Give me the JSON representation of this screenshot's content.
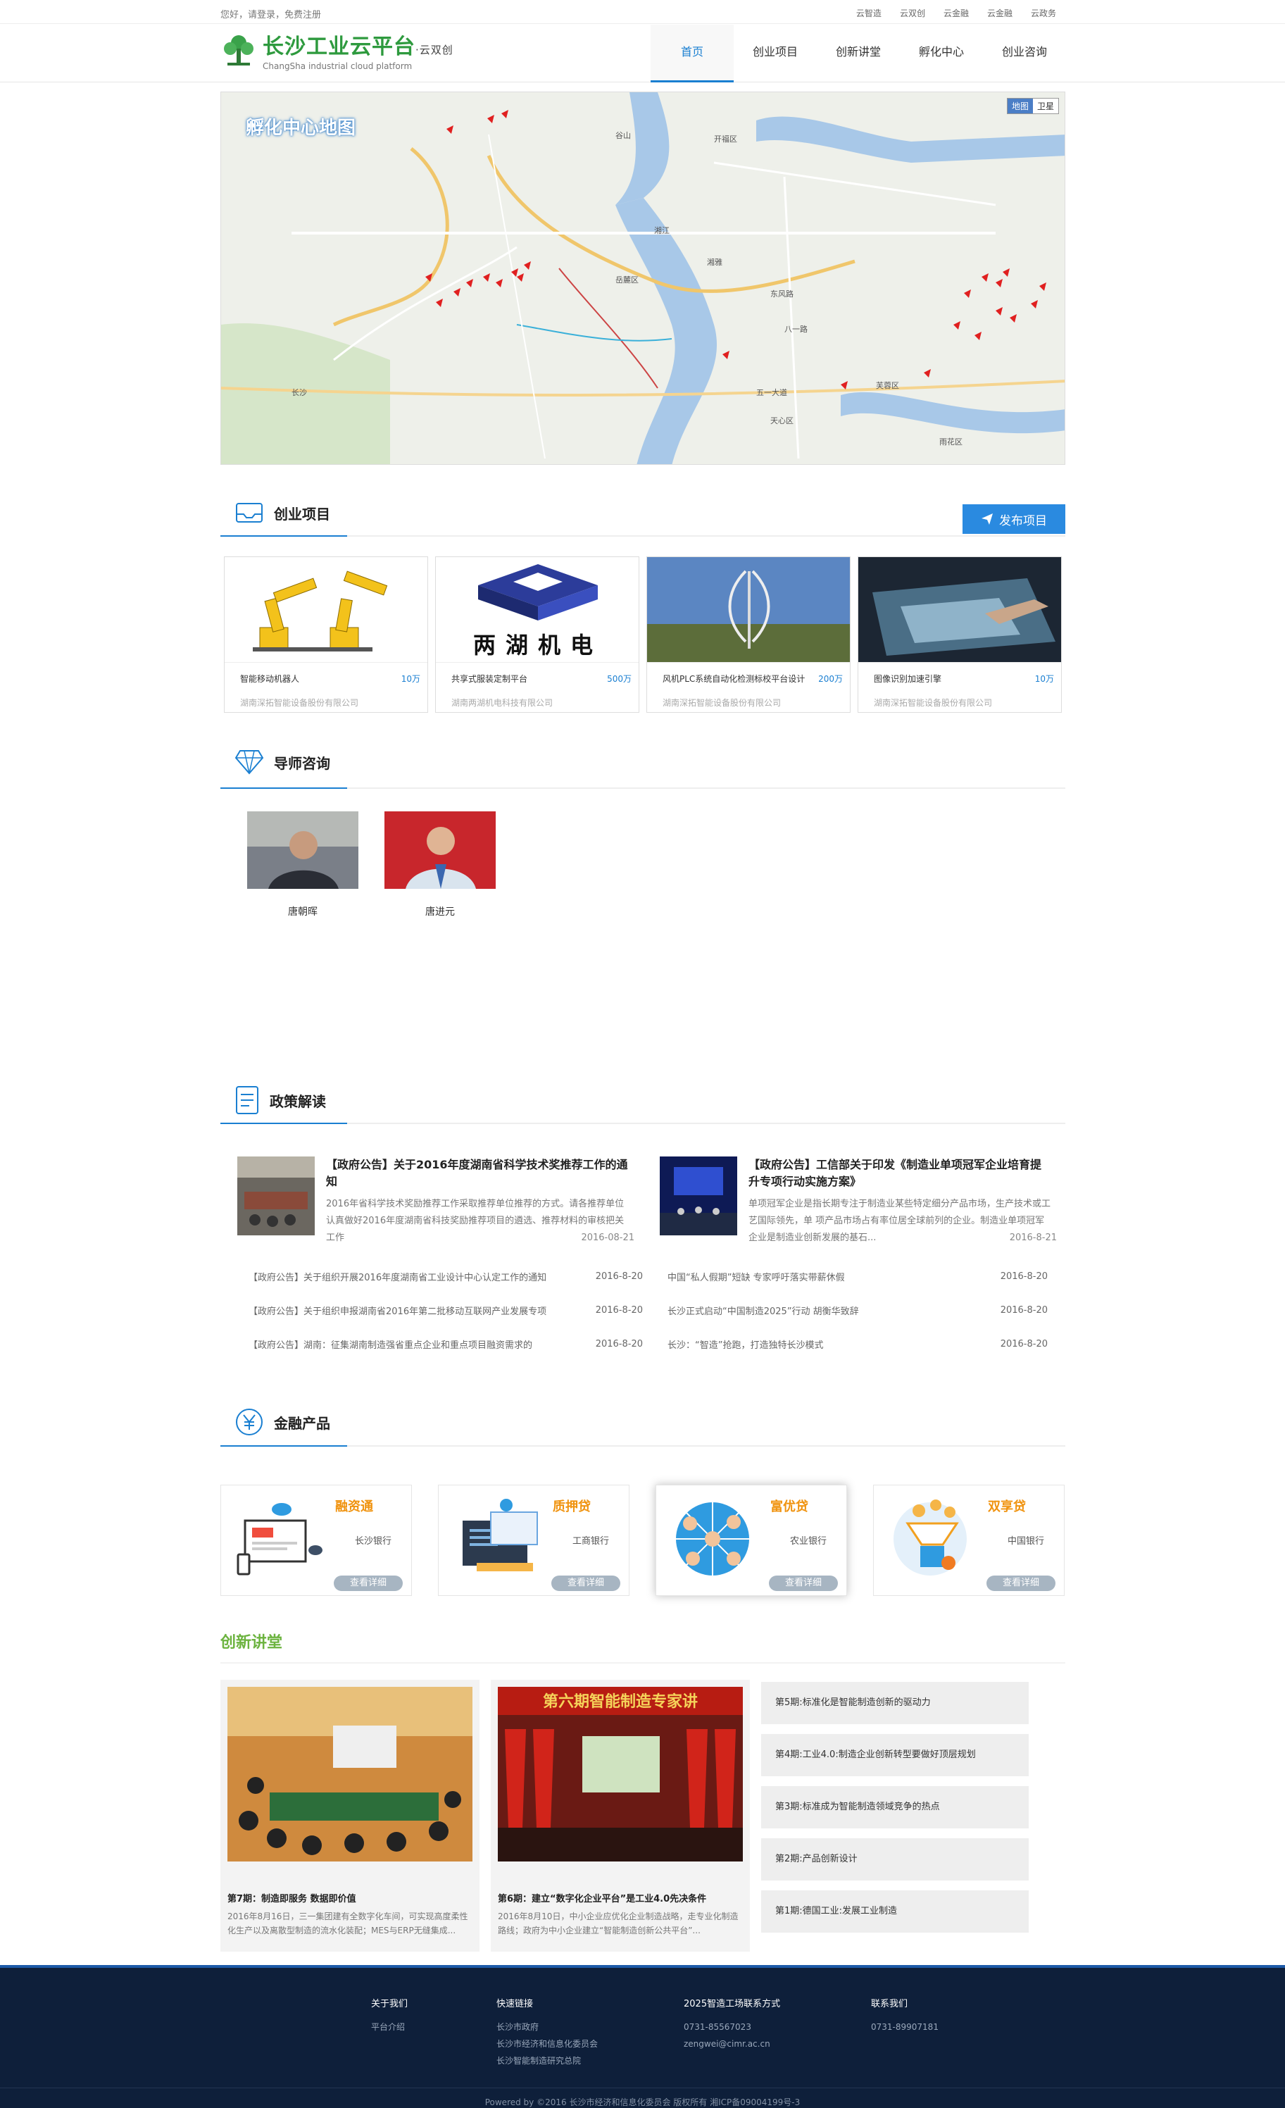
{
  "topbar": {
    "greeting": "您好，请登录，免费注册",
    "links": [
      "云智造",
      "云双创",
      "云金融",
      "云金融",
      "云政务"
    ]
  },
  "header": {
    "logo_cn": "长沙工业云平台",
    "logo_tag": "·云双创",
    "logo_en": "ChangSha industrial cloud platform",
    "nav": [
      "首页",
      "创业项目",
      "创新讲堂",
      "孵化中心",
      "创业咨询"
    ]
  },
  "map": {
    "title": "孵化中心地图",
    "toggle": [
      "地图",
      "卫星"
    ],
    "labels": [
      "谷山",
      "长沙",
      "开福区",
      "岳麓区",
      "湘雅",
      "东风路",
      "芙蓉区",
      "天心区",
      "雨花区",
      "五一大道",
      "八一路",
      "湘江"
    ]
  },
  "projects": {
    "title": "创业项目",
    "publish_label": "发布项目",
    "items": [
      {
        "name": "智能移动机器人",
        "money": "10万",
        "company": "湖南深拓智能设备股份有限公司"
      },
      {
        "name": "共享式服装定制平台",
        "money": "500万",
        "company": "湖南两湖机电科技有限公司",
        "logo_text": "两湖机电"
      },
      {
        "name": "风机PLC系统自动化检测标校平台设计",
        "money": "200万",
        "company": "湖南深拓智能设备股份有限公司"
      },
      {
        "name": "图像识别加速引擎",
        "money": "10万",
        "company": "湖南深拓智能设备股份有限公司"
      }
    ]
  },
  "tutors": {
    "title": "导师咨询",
    "items": [
      {
        "name": "唐朝晖"
      },
      {
        "name": "唐进元"
      }
    ]
  },
  "policy": {
    "title": "政策解读",
    "featured": [
      {
        "title": "【政府公告】关于2016年度湖南省科学技术奖推荐工作的通知",
        "desc": "2016年省科学技术奖励推荐工作采取推荐单位推荐的方式。请各推荐单位认真做好2016年度湖南省科技奖励推荐项目的遴选、推荐材料的审核把关工作",
        "date": "2016-08-21"
      },
      {
        "title": "【政府公告】工信部关于印发《制造业单项冠军企业培育提升专项行动实施方案》",
        "desc": "单项冠军企业是指长期专注于制造业某些特定细分产品市场，生产技术或工艺国际领先，单 项产品市场占有率位居全球前列的企业。制造业单项冠军企业是制造业创新发展的基石...",
        "date": "2016-8-21"
      }
    ],
    "left_list": [
      {
        "text": "【政府公告】关于组织开展2016年度湖南省工业设计中心认定工作的通知",
        "date": "2016-8-20"
      },
      {
        "text": "【政府公告】关于组织申报湖南省2016年第二批移动互联网产业发展专项",
        "date": "2016-8-20"
      },
      {
        "text": "【政府公告】湖南：征集湖南制造强省重点企业和重点项目融资需求的",
        "date": "2016-8-20"
      }
    ],
    "right_list": [
      {
        "text": "中国“私人假期”短缺 专家呼吁落实带薪休假",
        "date": "2016-8-20"
      },
      {
        "text": "长沙正式启动“中国制造2025”行动 胡衡华致辞",
        "date": "2016-8-20"
      },
      {
        "text": "长沙：“智造”抢跑，打造独特长沙模式",
        "date": "2016-8-20"
      }
    ]
  },
  "finance": {
    "title": "金融产品",
    "detail_label": "查看详细",
    "items": [
      {
        "name": "融资通",
        "bank": "长沙银行"
      },
      {
        "name": "质押贷",
        "bank": "工商银行"
      },
      {
        "name": "富优贷",
        "bank": "农业银行"
      },
      {
        "name": "双享贷",
        "bank": "中国银行"
      }
    ]
  },
  "lectures": {
    "title": "创新讲堂",
    "featured": [
      {
        "title": "第7期：制造即服务 数据即价值",
        "desc": "2016年8月16日，三一集团建有全数字化车间，可实现高度柔性化生产以及离散型制造的流水化装配；MES与ERP无缝集成..."
      },
      {
        "title": "第6期：建立“数字化企业平台”是工业4.0先决条件",
        "desc": "2016年8月10日，中小企业应优化企业制造战略，走专业化制造路线；政府为中小企业建立“智能制造创新公共平台”..."
      }
    ],
    "banner_text": "第六期智能制造专家讲",
    "list": [
      "第5期:标准化是智能制造创新的驱动力",
      "第4期:工业4.0:制造企业创新转型要做好顶层规划",
      "第3期:标准成为智能制造领域竞争的热点",
      "第2期:产品创新设计",
      "第1期:德国工业:发展工业制造"
    ]
  },
  "footer": {
    "about_title": "关于我们",
    "about_items": [
      "平台介绍"
    ],
    "quick_title": "快速链接",
    "quick_items": [
      "长沙市政府",
      "长沙市经济和信息化委员会",
      "长沙智能制造研究总院"
    ],
    "contact_title": "2025智造工场联系方式",
    "contact_items": [
      "0731-85567023",
      "zengwei@cimr.ac.cn"
    ],
    "us_title": "联系我们",
    "us_items": [
      "0731-89907181"
    ],
    "copyright": "Powered by ©2016 长沙市经济和信息化委员会   版权所有   湘ICP备09004199号-3"
  }
}
